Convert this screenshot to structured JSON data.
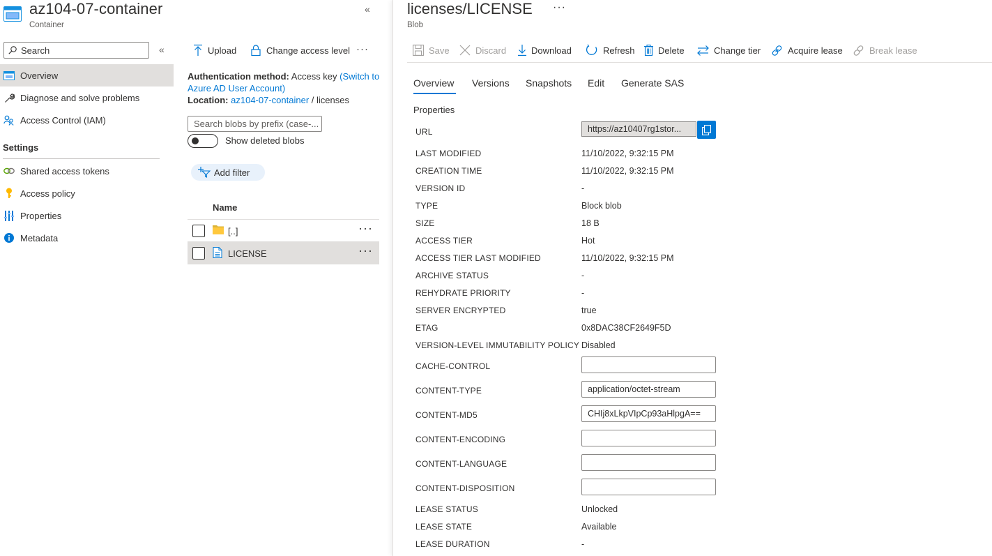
{
  "container": {
    "title": "az104-07-container",
    "subtitle": "Container",
    "search_placeholder": "Search",
    "menu": {
      "overview": "Overview",
      "diagnose": "Diagnose and solve problems",
      "iam": "Access Control (IAM)",
      "settings_header": "Settings",
      "shared_access_tokens": "Shared access tokens",
      "access_policy": "Access policy",
      "properties": "Properties",
      "metadata": "Metadata"
    },
    "commands": {
      "upload": "Upload",
      "change_access_level": "Change access level"
    },
    "auth": {
      "method_label": "Authentication method:",
      "method_value": "Access key",
      "switch_link_1": "(Switch to",
      "switch_link_2": "Azure AD User Account)",
      "location_label": "Location:",
      "location_link": "az104-07-container",
      "location_sep": "/",
      "location_folder": "licenses"
    },
    "prefix_search_placeholder": "Search blobs by prefix (case-...",
    "show_deleted_label": "Show deleted blobs",
    "add_filter_label": "Add filter",
    "column_name": "Name",
    "files": [
      {
        "name": "[..]",
        "type": "folder"
      },
      {
        "name": "LICENSE",
        "type": "file"
      }
    ]
  },
  "blob": {
    "title": "licenses/LICENSE",
    "subtitle": "Blob",
    "toolbar": {
      "save": "Save",
      "discard": "Discard",
      "download": "Download",
      "refresh": "Refresh",
      "delete": "Delete",
      "change_tier": "Change tier",
      "acquire_lease": "Acquire lease",
      "break_lease": "Break lease"
    },
    "tabs": [
      "Overview",
      "Versions",
      "Snapshots",
      "Edit",
      "Generate SAS"
    ],
    "properties_title": "Properties",
    "url_label": "URL",
    "url_value": "https://az10407rg1stor...",
    "props": [
      {
        "key": "LAST MODIFIED",
        "value": "11/10/2022, 9:32:15 PM"
      },
      {
        "key": "CREATION TIME",
        "value": "11/10/2022, 9:32:15 PM"
      },
      {
        "key": "VERSION ID",
        "value": "-"
      },
      {
        "key": "TYPE",
        "value": "Block blob"
      },
      {
        "key": "SIZE",
        "value": "18 B"
      },
      {
        "key": "ACCESS TIER",
        "value": "Hot"
      },
      {
        "key": "ACCESS TIER LAST MODIFIED",
        "value": "11/10/2022, 9:32:15 PM"
      },
      {
        "key": "ARCHIVE STATUS",
        "value": "-"
      },
      {
        "key": "REHYDRATE PRIORITY",
        "value": "-"
      },
      {
        "key": "SERVER ENCRYPTED",
        "value": "true"
      },
      {
        "key": "ETAG",
        "value": "0x8DAC38CF2649F5D"
      },
      {
        "key": "VERSION-LEVEL IMMUTABILITY POLICY",
        "value": "Disabled"
      }
    ],
    "inputs": [
      {
        "key": "CACHE-CONTROL",
        "value": ""
      },
      {
        "key": "CONTENT-TYPE",
        "value": "application/octet-stream"
      },
      {
        "key": "CONTENT-MD5",
        "value": "CHIj8xLkpVIpCp93aHlpgA=="
      },
      {
        "key": "CONTENT-ENCODING",
        "value": ""
      },
      {
        "key": "CONTENT-LANGUAGE",
        "value": ""
      },
      {
        "key": "CONTENT-DISPOSITION",
        "value": ""
      }
    ],
    "lease": [
      {
        "key": "LEASE STATUS",
        "value": "Unlocked"
      },
      {
        "key": "LEASE STATE",
        "value": "Available"
      },
      {
        "key": "LEASE DURATION",
        "value": "-"
      }
    ]
  }
}
